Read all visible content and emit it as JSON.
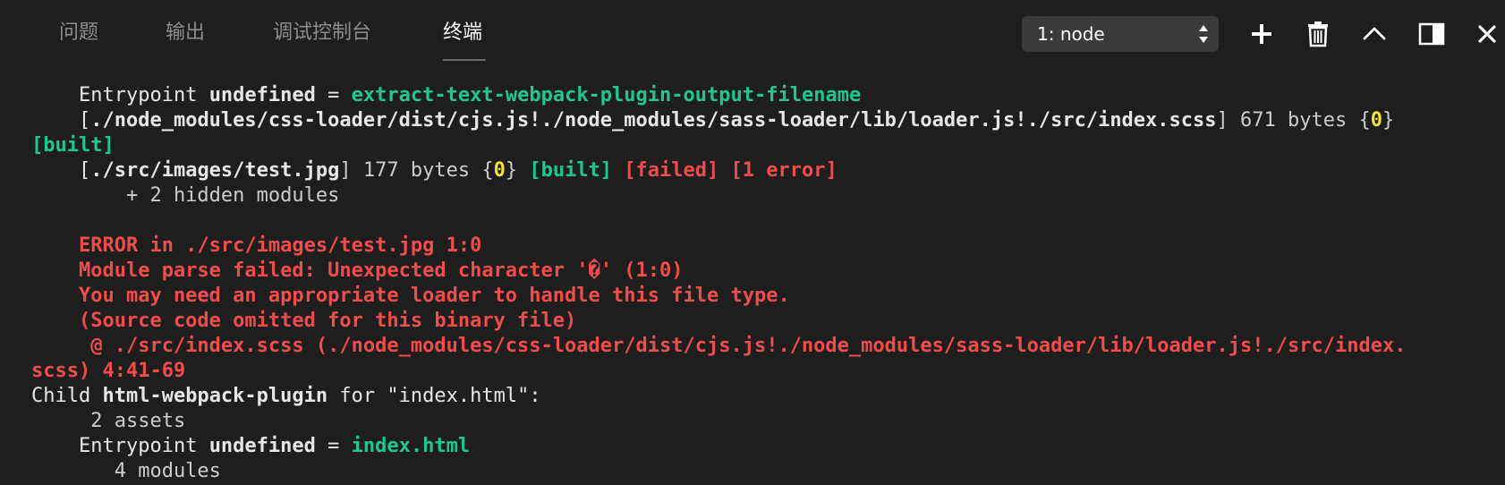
{
  "tabs": [
    {
      "label": "问题"
    },
    {
      "label": "输出"
    },
    {
      "label": "调试控制台"
    },
    {
      "label": "终端",
      "active": true
    }
  ],
  "terminal_select": {
    "value": "1: node"
  },
  "toolbar_icons": [
    "plus-icon",
    "trash-icon",
    "chevron-up-icon",
    "split-panel-icon",
    "close-icon"
  ],
  "colors": {
    "background": "#1e1e1e",
    "text": "#cccccc",
    "green": "#1ec88c",
    "yellow": "#f0e62e",
    "red": "#f14c4c",
    "select_bg": "#3a3a3a"
  },
  "terminal": {
    "l1": {
      "indent": "    ",
      "a": "Entrypoint ",
      "b": "undefined",
      "c": " = ",
      "d": "extract-text-webpack-plugin-output-filename"
    },
    "l2": {
      "indent": "    ",
      "a": "[",
      "b": "./node_modules/css-loader/dist/cjs.js!./node_modules/sass-loader/lib/loader.js!./src/index.scss",
      "c": "] 671 bytes {",
      "d": "0",
      "e": "}"
    },
    "l3": {
      "a": "[built]"
    },
    "l4": {
      "indent": "    ",
      "a": "[",
      "b": "./src/images/test.jpg",
      "c": "] 177 bytes {",
      "d": "0",
      "e": "} ",
      "f": "[built]",
      "g": " ",
      "h": "[failed] [1 error]"
    },
    "l5": {
      "text": "        + 2 hidden modules"
    },
    "l6": {
      "text": "    ERROR in ./src/images/test.jpg 1:0"
    },
    "l7": {
      "text": "    Module parse failed: Unexpected character '�' (1:0)"
    },
    "l8": {
      "text": "    You may need an appropriate loader to handle this file type."
    },
    "l9": {
      "text": "    (Source code omitted for this binary file)"
    },
    "l10": {
      "text": "     @ ./src/index.scss (./node_modules/css-loader/dist/cjs.js!./node_modules/sass-loader/lib/loader.js!./src/index."
    },
    "l11": {
      "text": "scss) 4:41-69"
    },
    "l12": {
      "a": "Child ",
      "b": "html-webpack-plugin",
      "c": " for ",
      "d": "\"index.html\"",
      "e": ":"
    },
    "l13": {
      "text": "     2 assets"
    },
    "l14": {
      "indent": "    ",
      "a": "Entrypoint ",
      "b": "undefined",
      "c": " = ",
      "d": "index.html"
    },
    "l15": {
      "text": "       4 modules"
    }
  }
}
